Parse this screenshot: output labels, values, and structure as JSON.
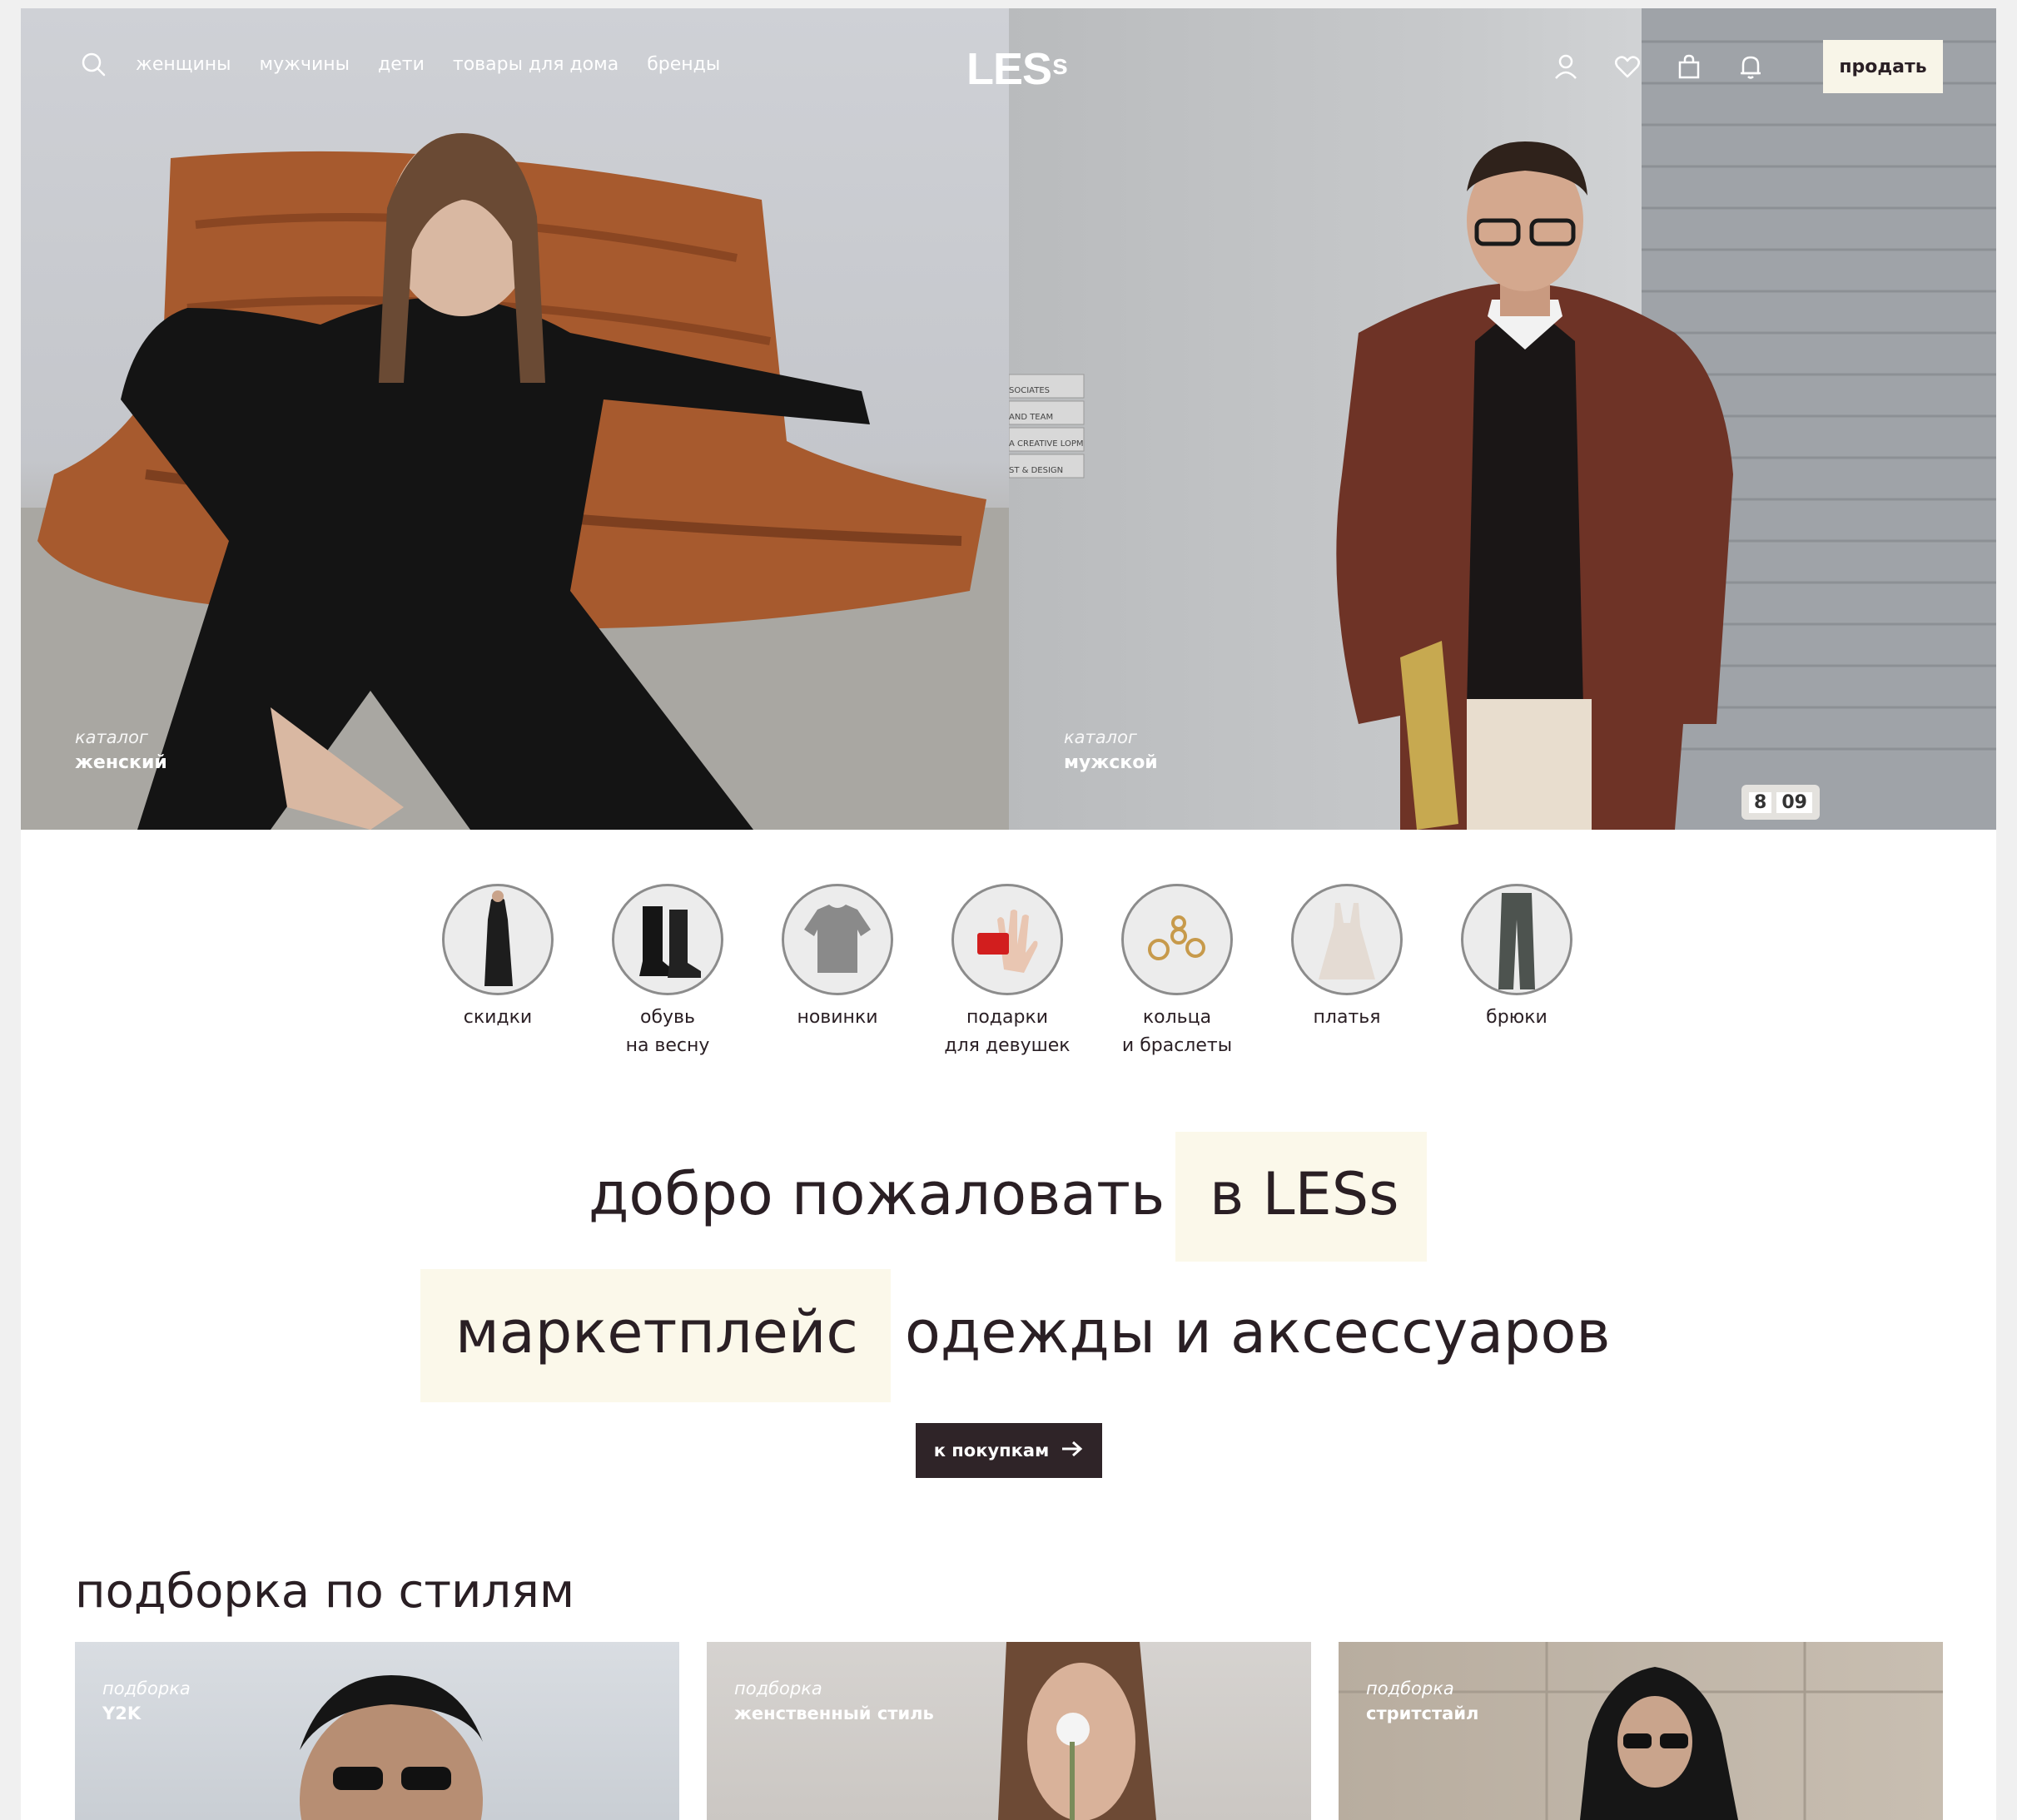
{
  "nav": {
    "links": [
      "женщины",
      "мужчины",
      "дети",
      "товары для дома",
      "бренды"
    ],
    "logo_main": "LES",
    "logo_small": "s",
    "sell_label": "продать"
  },
  "hero": {
    "women": {
      "small": "каталог",
      "big": "женский"
    },
    "men": {
      "small": "каталог",
      "big": "мужской"
    },
    "wall_signs": [
      "SOCIATES",
      "AND TEAM",
      "A CREATIVE\nLOPMENT",
      "ST & DESIGN"
    ],
    "clock": [
      "8",
      "09"
    ]
  },
  "categories": [
    {
      "label": "скидки"
    },
    {
      "label": "обувь\nна весну"
    },
    {
      "label": "новинки"
    },
    {
      "label": "подарки\nдля девушек"
    },
    {
      "label": "кольца\nи браслеты"
    },
    {
      "label": "платья"
    },
    {
      "label": "брюки"
    }
  ],
  "welcome": {
    "line1_a": "добро пожаловать",
    "line1_b": "в LESs",
    "line2_a": "маркетплейс",
    "line2_b": "одежды и аксессуаров",
    "cta_label": "к покупкам"
  },
  "styles": {
    "title": "подборка по стилям",
    "cards": [
      {
        "small": "подборка",
        "big": "Y2K"
      },
      {
        "small": "подборка",
        "big": "женственный стиль"
      },
      {
        "small": "подборка",
        "big": "стритстайл"
      }
    ]
  }
}
